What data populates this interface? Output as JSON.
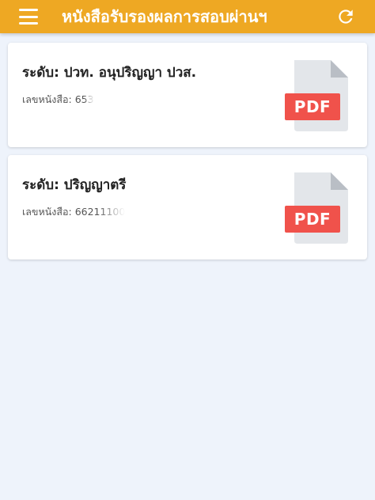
{
  "appbar": {
    "title": "หนังสือรับรองผลการสอบผ่านฯ",
    "menu_icon": "hamburger-menu-icon",
    "refresh_icon": "refresh-icon"
  },
  "colors": {
    "appbar_bg": "#eea823",
    "page_bg": "#eef3fb",
    "pdf_badge": "#f0524b"
  },
  "certificates": [
    {
      "level_label": "ระดับ: ปวท. อนุปริญญา ปวส.",
      "number_label": "เลขหนังสือ:",
      "number_value": "653",
      "file_type": "PDF",
      "icon": "pdf-file-icon"
    },
    {
      "level_label": "ระดับ: ปริญญาตรี",
      "number_label": "เลขหนังสือ:",
      "number_value": "66211100",
      "file_type": "PDF",
      "icon": "pdf-file-icon"
    }
  ]
}
